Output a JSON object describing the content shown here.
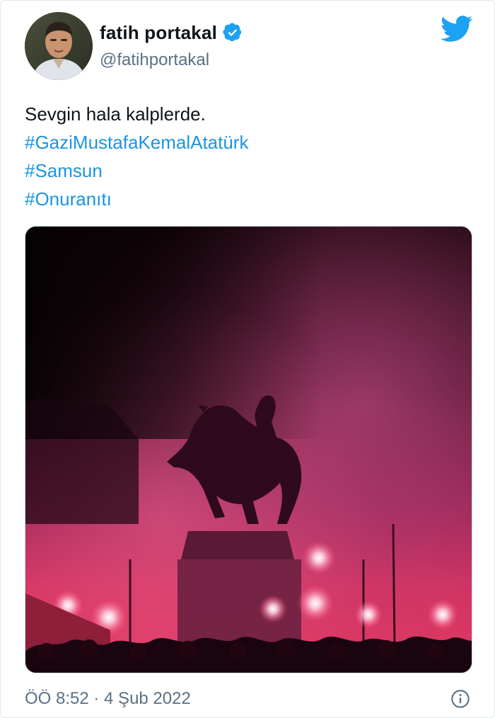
{
  "author": {
    "display_name": "fatih portakal",
    "handle": "@fatihportakal",
    "verified": true,
    "avatar_icon": "avatar-photo"
  },
  "brand": {
    "icon": "twitter-bird-icon",
    "color": "#1da1f2"
  },
  "tweet": {
    "text_line": "Sevgin hala kalplerde.",
    "hashtags": [
      "#GaziMustafaKemalAtatürk",
      "#Samsun",
      "#Onuranıtı"
    ],
    "hashtag_color": "#1b95e0"
  },
  "media": {
    "type": "photo",
    "subject": "equestrian-statue-with-red-flares"
  },
  "footer": {
    "timestamp": "ÖÖ 8:52 · 4 Şub 2022",
    "info_icon": "info-icon"
  }
}
